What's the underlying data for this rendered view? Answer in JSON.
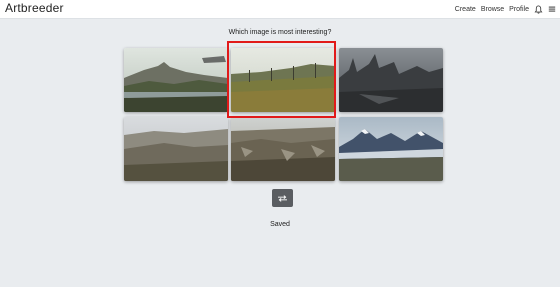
{
  "app": {
    "logo": "Artbreeder"
  },
  "nav": {
    "create": "Create",
    "browse": "Browse",
    "profile": "Profile"
  },
  "question": "Which image is most interesting?",
  "status": "Saved",
  "colors": {
    "selection": "#e11a1a",
    "button": "#5a5d61",
    "background": "#e9ecef"
  },
  "icons": {
    "notifications": "bell-icon",
    "menu": "hamburger-menu-icon",
    "shuffle": "shuffle-icon"
  },
  "images": [
    {
      "id": "landscape-1",
      "selected": false
    },
    {
      "id": "landscape-2",
      "selected": true
    },
    {
      "id": "landscape-3",
      "selected": false
    },
    {
      "id": "landscape-4",
      "selected": false
    },
    {
      "id": "landscape-5",
      "selected": false
    },
    {
      "id": "landscape-6",
      "selected": false
    }
  ]
}
